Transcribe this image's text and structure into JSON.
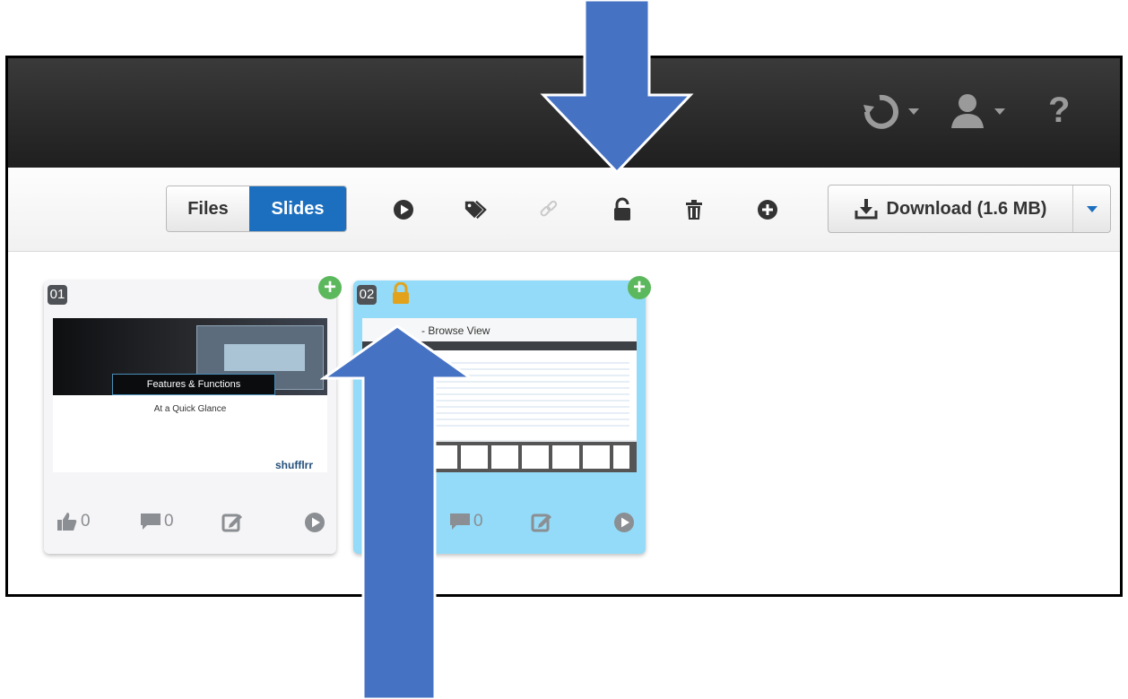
{
  "toolbar": {
    "files_label": "Files",
    "slides_label": "Slides",
    "download_label": "Download (1.6 MB)"
  },
  "slides": [
    {
      "number": "01",
      "thumb_title": "Features & Functions",
      "thumb_subtitle": "At a Quick Glance",
      "thumb_logo": "shufflrr",
      "likes": "0",
      "comments": "0"
    },
    {
      "number": "02",
      "thumb_title": "- Browse View",
      "locked": true,
      "comments": "0"
    }
  ],
  "colors": {
    "accent": "#1c6fbf",
    "selected_card": "#93dbf8",
    "add_green": "#5cb85c",
    "lock_gold": "#e2a21b",
    "annotation_arrow": "#4672c4"
  }
}
